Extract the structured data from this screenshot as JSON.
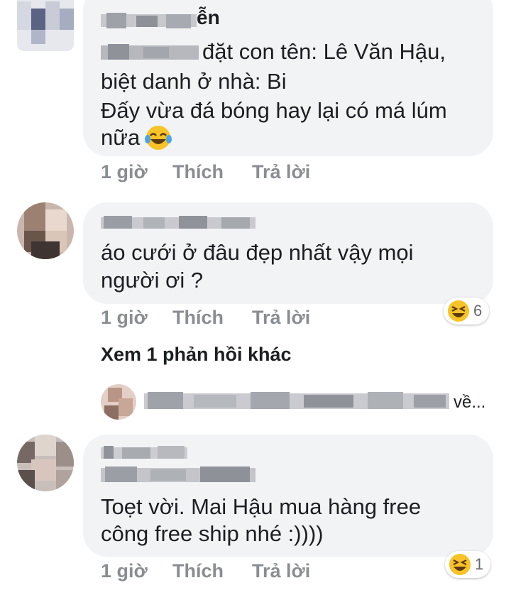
{
  "comments": [
    {
      "author_visible_suffix": "ễn",
      "lines": [
        "đặt con tên: Lê Văn Hậu,",
        "biệt danh ở nhà: Bi",
        "Đấy vừa đá bóng hay lại có má lúm",
        "nữa"
      ],
      "inline_emoji": "laughing-tears-emoji",
      "time": "1 giờ",
      "like": "Thích",
      "reply": "Trả lời"
    },
    {
      "lines": [
        "áo cưới ở đâu đẹp nhất vậy mọi",
        "người ơi ?"
      ],
      "time": "1 giờ",
      "like": "Thích",
      "reply": "Trả lời",
      "reaction": {
        "icon": "haha-emoji",
        "count": "6"
      }
    },
    {
      "lines": [
        "Toẹt vời. Mai Hậu mua hàng free",
        "công free ship nhé :))))"
      ],
      "time": "1 giờ",
      "like": "Thích",
      "reply": "Trả lời",
      "reaction": {
        "icon": "haha-emoji",
        "count": "1"
      }
    }
  ],
  "see_more_replies": "Xem 1 phản hồi khác",
  "reply_preview_suffix": "về..."
}
